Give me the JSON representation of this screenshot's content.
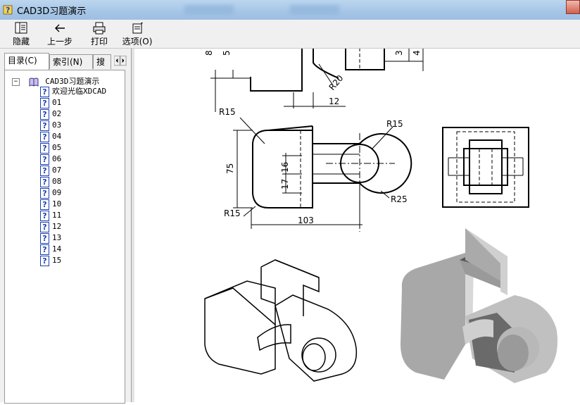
{
  "window": {
    "title": "CAD3D习题演示"
  },
  "toolbar": {
    "hide_label": "隐藏",
    "back_label": "上一步",
    "print_label": "打印",
    "options_label": "选项(O)"
  },
  "tabs": [
    {
      "label": "目录(C)"
    },
    {
      "label": "索引(N)"
    },
    {
      "label": "搜"
    }
  ],
  "tree": {
    "root_label": "CAD3D习题演示",
    "items": [
      {
        "label": "欢迎光临XDCAD"
      },
      {
        "label": "01"
      },
      {
        "label": "02"
      },
      {
        "label": "03"
      },
      {
        "label": "04"
      },
      {
        "label": "05"
      },
      {
        "label": "06"
      },
      {
        "label": "07"
      },
      {
        "label": "08"
      },
      {
        "label": "09"
      },
      {
        "label": "10"
      },
      {
        "label": "11"
      },
      {
        "label": "12"
      },
      {
        "label": "13"
      },
      {
        "label": "14"
      },
      {
        "label": "15"
      }
    ]
  },
  "drawing": {
    "dims": {
      "d8": "8",
      "d5": "5",
      "d3": "3",
      "d4": "4",
      "r20": "R20",
      "d12": "12",
      "r15_top": "R15",
      "r15_right": "R15",
      "d75": "75",
      "d16": "16",
      "d17": "17",
      "r15_bottom": "R15",
      "r25": "R25",
      "d103": "103"
    }
  }
}
